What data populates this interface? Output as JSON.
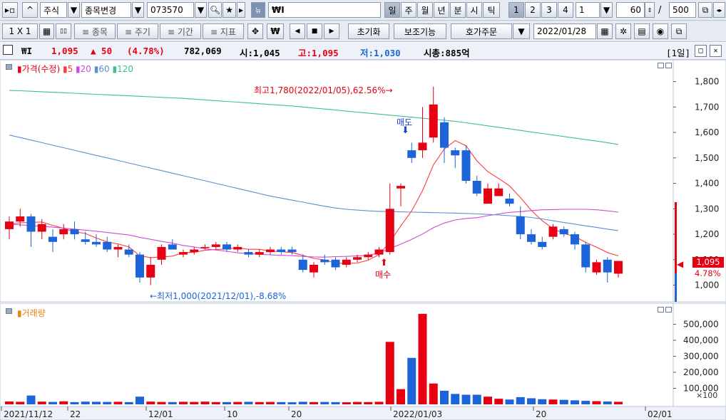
{
  "toolbar": {
    "market": "주식",
    "symbol_change": "종목변경",
    "code": "073570",
    "name": "₩I",
    "timeframes": [
      "일",
      "주",
      "월",
      "년",
      "분",
      "시",
      "틱"
    ],
    "multipliers": [
      "1",
      "2",
      "3",
      "4"
    ],
    "interval_value": "1",
    "count_value": "60",
    "slash": "/",
    "max_count": "500",
    "layout_label": "1 X 1",
    "btn_item": "≡ 종목",
    "btn_period": "≡ 주기",
    "btn_range": "≡ 기간",
    "btn_indicator": "≡ 지표",
    "won_symbol": "₩",
    "reset_label": "초기화",
    "aux_label": "보조기능",
    "order_label": "호가주문",
    "date_value": "2022/01/28"
  },
  "info": {
    "name": "₩I",
    "price": "1,095",
    "change": "▲ 50",
    "change_rate": "(4.78%)",
    "volume": "782,069",
    "open": "시:1,045",
    "high": "고:1,095",
    "low": "저:1,030",
    "market_cap": "시총:885억",
    "period_badge": "[1일]"
  },
  "price_panel": {
    "legend_main": "가격(수정)",
    "legend_ma": [
      "5",
      "20",
      "60",
      "120"
    ],
    "current_price_tag": "1,095",
    "current_rate_tag": "4.78%",
    "high_annotation": "최고1,780(2022/01/05),62.56%→",
    "low_annotation": "←최저1,000(2021/12/01),-8.68%",
    "sell_label": "매도",
    "buy_label": "매수"
  },
  "volume_panel": {
    "legend": "거래량",
    "scale_note": "×100"
  },
  "colors": {
    "up": "#e60012",
    "down": "#1c64d8",
    "ma5": "#ff3b3b",
    "ma20": "#d04ad8",
    "ma60": "#5b8fd0",
    "ma120": "#3cbf93"
  },
  "chart_data": [
    {
      "type": "candlestick",
      "title": "",
      "x_tick_labels": [
        "2021/11/12",
        "22",
        "12/01",
        "10",
        "20",
        "2022/01/03",
        "20",
        "02/01"
      ],
      "y_tick_labels": [
        "1,000",
        "1,100",
        "1,200",
        "1,300",
        "1,400",
        "1,500",
        "1,600",
        "1,700",
        "1,800"
      ],
      "ylim": [
        940,
        1880
      ],
      "candles": [
        {
          "o": 1220,
          "h": 1270,
          "l": 1180,
          "c": 1250
        },
        {
          "o": 1250,
          "h": 1300,
          "l": 1230,
          "c": 1270
        },
        {
          "o": 1270,
          "h": 1280,
          "l": 1150,
          "c": 1210
        },
        {
          "o": 1210,
          "h": 1260,
          "l": 1180,
          "c": 1240
        },
        {
          "o": 1190,
          "h": 1220,
          "l": 1130,
          "c": 1170
        },
        {
          "o": 1200,
          "h": 1240,
          "l": 1180,
          "c": 1220
        },
        {
          "o": 1220,
          "h": 1250,
          "l": 1180,
          "c": 1200
        },
        {
          "o": 1180,
          "h": 1210,
          "l": 1160,
          "c": 1170
        },
        {
          "o": 1170,
          "h": 1200,
          "l": 1150,
          "c": 1160
        },
        {
          "o": 1170,
          "h": 1190,
          "l": 1130,
          "c": 1140
        },
        {
          "o": 1140,
          "h": 1160,
          "l": 1110,
          "c": 1150
        },
        {
          "o": 1140,
          "h": 1160,
          "l": 1110,
          "c": 1120
        },
        {
          "o": 1120,
          "h": 1130,
          "l": 1010,
          "c": 1030
        },
        {
          "o": 1030,
          "h": 1110,
          "l": 1000,
          "c": 1080
        },
        {
          "o": 1100,
          "h": 1160,
          "l": 1080,
          "c": 1150
        },
        {
          "o": 1160,
          "h": 1180,
          "l": 1140,
          "c": 1140
        },
        {
          "o": 1120,
          "h": 1140,
          "l": 1110,
          "c": 1130
        },
        {
          "o": 1130,
          "h": 1150,
          "l": 1120,
          "c": 1140
        },
        {
          "o": 1150,
          "h": 1160,
          "l": 1140,
          "c": 1150
        },
        {
          "o": 1150,
          "h": 1170,
          "l": 1140,
          "c": 1160
        },
        {
          "o": 1160,
          "h": 1170,
          "l": 1130,
          "c": 1140
        },
        {
          "o": 1140,
          "h": 1160,
          "l": 1130,
          "c": 1150
        },
        {
          "o": 1130,
          "h": 1140,
          "l": 1110,
          "c": 1120
        },
        {
          "o": 1120,
          "h": 1140,
          "l": 1110,
          "c": 1130
        },
        {
          "o": 1130,
          "h": 1150,
          "l": 1120,
          "c": 1140
        },
        {
          "o": 1140,
          "h": 1150,
          "l": 1120,
          "c": 1130
        },
        {
          "o": 1140,
          "h": 1150,
          "l": 1120,
          "c": 1130
        },
        {
          "o": 1100,
          "h": 1120,
          "l": 1050,
          "c": 1060
        },
        {
          "o": 1050,
          "h": 1090,
          "l": 1030,
          "c": 1080
        },
        {
          "o": 1100,
          "h": 1120,
          "l": 1080,
          "c": 1090
        },
        {
          "o": 1100,
          "h": 1110,
          "l": 1060,
          "c": 1070
        },
        {
          "o": 1080,
          "h": 1110,
          "l": 1070,
          "c": 1100
        },
        {
          "o": 1100,
          "h": 1120,
          "l": 1090,
          "c": 1110
        },
        {
          "o": 1110,
          "h": 1130,
          "l": 1100,
          "c": 1120
        },
        {
          "o": 1120,
          "h": 1150,
          "l": 1110,
          "c": 1140
        },
        {
          "o": 1130,
          "h": 1400,
          "l": 1120,
          "c": 1300
        },
        {
          "o": 1380,
          "h": 1400,
          "l": 1310,
          "c": 1390
        },
        {
          "o": 1530,
          "h": 1560,
          "l": 1480,
          "c": 1500
        },
        {
          "o": 1530,
          "h": 1700,
          "l": 1500,
          "c": 1560
        },
        {
          "o": 1580,
          "h": 1780,
          "l": 1560,
          "c": 1710
        },
        {
          "o": 1640,
          "h": 1660,
          "l": 1480,
          "c": 1540
        },
        {
          "o": 1530,
          "h": 1540,
          "l": 1460,
          "c": 1510
        },
        {
          "o": 1530,
          "h": 1550,
          "l": 1400,
          "c": 1410
        },
        {
          "o": 1410,
          "h": 1430,
          "l": 1350,
          "c": 1360
        },
        {
          "o": 1320,
          "h": 1400,
          "l": 1320,
          "c": 1380
        },
        {
          "o": 1350,
          "h": 1400,
          "l": 1350,
          "c": 1380
        },
        {
          "o": 1340,
          "h": 1360,
          "l": 1310,
          "c": 1320
        },
        {
          "o": 1270,
          "h": 1310,
          "l": 1180,
          "c": 1200
        },
        {
          "o": 1200,
          "h": 1220,
          "l": 1160,
          "c": 1170
        },
        {
          "o": 1170,
          "h": 1190,
          "l": 1140,
          "c": 1150
        },
        {
          "o": 1190,
          "h": 1240,
          "l": 1180,
          "c": 1230
        },
        {
          "o": 1220,
          "h": 1230,
          "l": 1190,
          "c": 1200
        },
        {
          "o": 1200,
          "h": 1210,
          "l": 1140,
          "c": 1160
        },
        {
          "o": 1160,
          "h": 1170,
          "l": 1050,
          "c": 1070
        },
        {
          "o": 1050,
          "h": 1100,
          "l": 1040,
          "c": 1090
        },
        {
          "o": 1100,
          "h": 1110,
          "l": 1010,
          "c": 1050
        },
        {
          "o": 1045,
          "h": 1095,
          "l": 1030,
          "c": 1095
        }
      ],
      "moving_averages": [
        {
          "name": "5",
          "values": [
            1240,
            1245,
            1247,
            1248,
            1235,
            1223,
            1210,
            1203,
            1185,
            1170,
            1162,
            1150,
            1115,
            1108,
            1111,
            1114,
            1128,
            1129,
            1137,
            1140,
            1142,
            1147,
            1141,
            1141,
            1134,
            1132,
            1128,
            1117,
            1105,
            1099,
            1087,
            1085,
            1087,
            1098,
            1120,
            1170,
            1233,
            1292,
            1371,
            1473,
            1535,
            1568,
            1548,
            1488,
            1446,
            1419,
            1390,
            1344,
            1294,
            1253,
            1222,
            1203,
            1191,
            1168,
            1149,
            1128,
            1115
          ]
        },
        {
          "name": "20",
          "values": [
            1239,
            1237,
            1234,
            1231,
            1228,
            1224,
            1220,
            1216,
            1212,
            1207,
            1202,
            1197,
            1188,
            1180,
            1172,
            1165,
            1156,
            1150,
            1143,
            1138,
            1133,
            1127,
            1124,
            1121,
            1119,
            1117,
            1116,
            1113,
            1111,
            1110,
            1112,
            1113,
            1115,
            1117,
            1127,
            1144,
            1161,
            1180,
            1201,
            1226,
            1244,
            1256,
            1262,
            1265,
            1273,
            1280,
            1286,
            1289,
            1293,
            1296,
            1297,
            1298,
            1298,
            1298,
            1296,
            1292,
            1287
          ]
        },
        {
          "name": "60",
          "values": [
            1590,
            1580,
            1570,
            1560,
            1550,
            1540,
            1530,
            1520,
            1510,
            1500,
            1490,
            1480,
            1470,
            1460,
            1450,
            1440,
            1430,
            1420,
            1410,
            1400,
            1390,
            1380,
            1370,
            1360,
            1350,
            1342,
            1334,
            1326,
            1318,
            1310,
            1303,
            1298,
            1295,
            1292,
            1290,
            1289,
            1288,
            1287,
            1286,
            1285,
            1284,
            1283,
            1282,
            1280,
            1278,
            1276,
            1273,
            1270,
            1266,
            1260,
            1253,
            1246,
            1240,
            1233,
            1227,
            1220,
            1214
          ]
        },
        {
          "name": "120",
          "values": [
            1765,
            1764,
            1762,
            1760,
            1758,
            1756,
            1754,
            1752,
            1750,
            1748,
            1746,
            1744,
            1742,
            1740,
            1738,
            1736,
            1734,
            1731,
            1728,
            1725,
            1722,
            1719,
            1716,
            1713,
            1710,
            1707,
            1704,
            1700,
            1696,
            1692,
            1688,
            1684,
            1680,
            1676,
            1672,
            1668,
            1664,
            1660,
            1656,
            1652,
            1648,
            1644,
            1638,
            1632,
            1626,
            1620,
            1614,
            1608,
            1602,
            1596,
            1590,
            1584,
            1578,
            1572,
            1566,
            1560,
            1553
          ]
        }
      ]
    },
    {
      "type": "bar",
      "title": "",
      "y_tick_labels": [
        "100,000",
        "200,000",
        "300,000",
        "400,000",
        "500,000"
      ],
      "ylim": [
        0,
        600000
      ],
      "values": [
        18000,
        16000,
        55000,
        17000,
        15000,
        19000,
        14000,
        17000,
        16000,
        15000,
        16000,
        14000,
        48000,
        17000,
        15000,
        14000,
        16000,
        15000,
        17000,
        14000,
        14000,
        15000,
        16000,
        14000,
        15000,
        14000,
        13000,
        16000,
        14000,
        15000,
        14000,
        13000,
        15000,
        14000,
        16000,
        390000,
        95000,
        290000,
        565000,
        130000,
        85000,
        65000,
        60000,
        60000,
        48000,
        35000,
        30000,
        45000,
        38000,
        32000,
        30000,
        28000,
        25000,
        22000,
        20000,
        18000,
        16000
      ]
    }
  ]
}
